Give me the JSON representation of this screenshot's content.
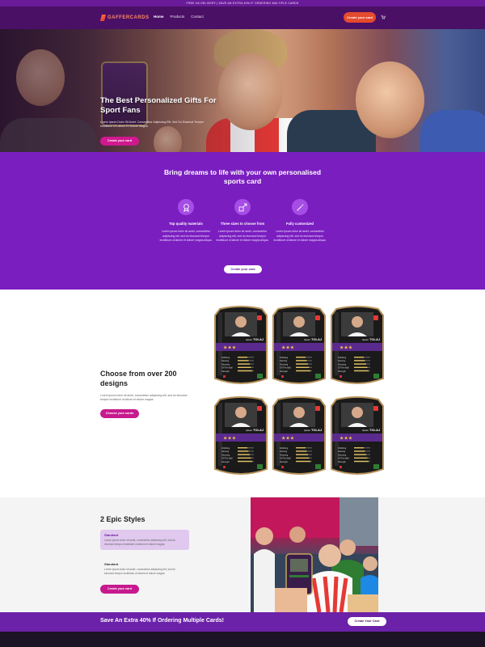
{
  "promo_bar": {
    "text": "FREE UK DELIVERY | SAVE AN EXTRA 40% IF ORDERING MULTIPLE CARDS"
  },
  "nav": {
    "logo": "GAFFERCARDS",
    "links": [
      {
        "label": "Home",
        "active": true
      },
      {
        "label": "Products",
        "active": false
      },
      {
        "label": "Contact",
        "active": false
      }
    ],
    "cta": "Create your card",
    "cart_icon": "cart-icon"
  },
  "hero": {
    "title": "The Best Personalized Gifts For Sport Fans",
    "text": "Lorem Ipsum Dolor Sit Amet, Consectetur Adipiscing Elit, Sed Do Eiusmod Tempor Incididunt Ut Labore Et Dolore Magna.",
    "button": "Create your card"
  },
  "features": {
    "title": "Bring dreams to life with your own personalised sports card",
    "items": [
      {
        "icon": "medal-icon",
        "title": "Top quality materials",
        "text": "Lorem ipsum dolor sit amet, consectetur adipiscing elit, sed do eiusmod tempor incididunt ut labore et dolore magna aliqua."
      },
      {
        "icon": "resize-icon",
        "title": "Three sizes to choose from",
        "text": "Lorem ipsum dolor sit amet, consectetur adipiscing elit, sed do eiusmod tempor incididunt ut labore et dolore magna aliqua."
      },
      {
        "icon": "magic-wand-icon",
        "title": "Fully customized",
        "text": "Lorem ipsum dolor sit amet, consectetur adipiscing elit, sed do eiusmod tempor incididunt ut labore et dolore magna aliqua."
      }
    ],
    "button": "Create your card"
  },
  "designs": {
    "title": "Choose from over 200 designs",
    "text": "Lorem ipsum dolor sit amet, consectetur adipiscing elit, sed do eiusmod tempor incididunt ut labore et dolore magna.",
    "button": "Choose your cards",
    "card": {
      "name": "TOLAJ",
      "first_name": "Ipsum",
      "stats": [
        "Dribbling",
        "Passing",
        "Shooting",
        "Off The Ball",
        "Strength"
      ]
    }
  },
  "styles": {
    "title": "2 Epic Styles",
    "options": [
      {
        "name": "Standard",
        "text": "Lorem ipsum dolor sit amet, consectetur adipiscing elit, sed do eiusmod tempor incididunt ut labore et dolore magna.",
        "active": true
      },
      {
        "name": "Standard",
        "text": "Lorem ipsum dolor sit amet, consectetur adipiscing elit, sed do eiusmod tempor incididunt ut labore et dolore magna.",
        "active": false
      }
    ],
    "button": "Create your card"
  },
  "cta_banner": {
    "text": "Save An Extra 40% If Ordering Multiple Cards!",
    "button": "Create Your Card"
  },
  "colors": {
    "brand_purple": "#7a1ec0",
    "dark_purple": "#4a1066",
    "pink": "#c71a8e",
    "orange": "#e64a2e"
  }
}
